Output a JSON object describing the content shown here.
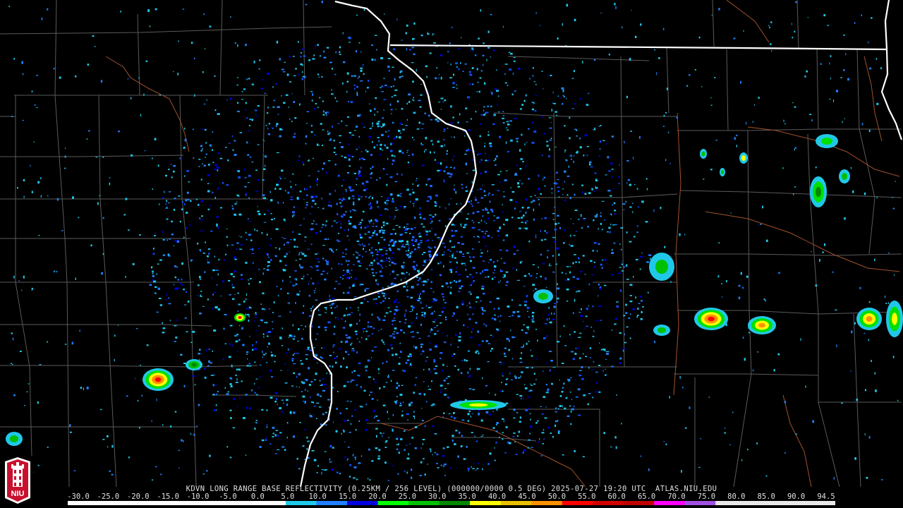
{
  "title": "KDVN LONG RANGE BASE REFLECTIVITY (0.25KM / 256 LEVEL) (000000/0000 0.5 DEG) 2025-07-27 19:20 UTC  ATLAS.NIU.EDU",
  "logo": {
    "text": "NIU",
    "icon": "niu-tower-logo-icon",
    "bg": "#c8102e"
  },
  "scale": {
    "labels": [
      "-30.0",
      "-25.0",
      "-20.0",
      "-15.0",
      "-10.0",
      "-5.0",
      "0.0",
      "5.0",
      "10.0",
      "15.0",
      "20.0",
      "25.0",
      "30.0",
      "35.0",
      "40.0",
      "45.0",
      "50.0",
      "55.0",
      "60.0",
      "65.0",
      "70.0",
      "75.0",
      "80.0",
      "85.0",
      "90.0",
      "94.5"
    ],
    "stops": [
      {
        "v": -30,
        "c": "#ffffff"
      },
      {
        "v": 0,
        "c": "#ffffff"
      },
      {
        "v": 5,
        "c": "#20c8e8"
      },
      {
        "v": 10,
        "c": "#2080ff"
      },
      {
        "v": 15,
        "c": "#0000e0"
      },
      {
        "v": 20,
        "c": "#00ff00"
      },
      {
        "v": 25,
        "c": "#00c000"
      },
      {
        "v": 30,
        "c": "#008800"
      },
      {
        "v": 35,
        "c": "#ffff00"
      },
      {
        "v": 40,
        "c": "#e8c000"
      },
      {
        "v": 45,
        "c": "#ff9000"
      },
      {
        "v": 50,
        "c": "#ff0000"
      },
      {
        "v": 55,
        "c": "#d00000"
      },
      {
        "v": 60,
        "c": "#c00000"
      },
      {
        "v": 65,
        "c": "#ff00ff"
      },
      {
        "v": 70,
        "c": "#a050e0"
      },
      {
        "v": 75,
        "c": "#e8e8e8"
      },
      {
        "v": 94.5,
        "c": "#ffffff"
      }
    ]
  },
  "colors": {
    "county_lines": "#5a5a5a",
    "state_lines": "#ffffff",
    "rivers": "#a0522d",
    "background": "#000000"
  }
}
